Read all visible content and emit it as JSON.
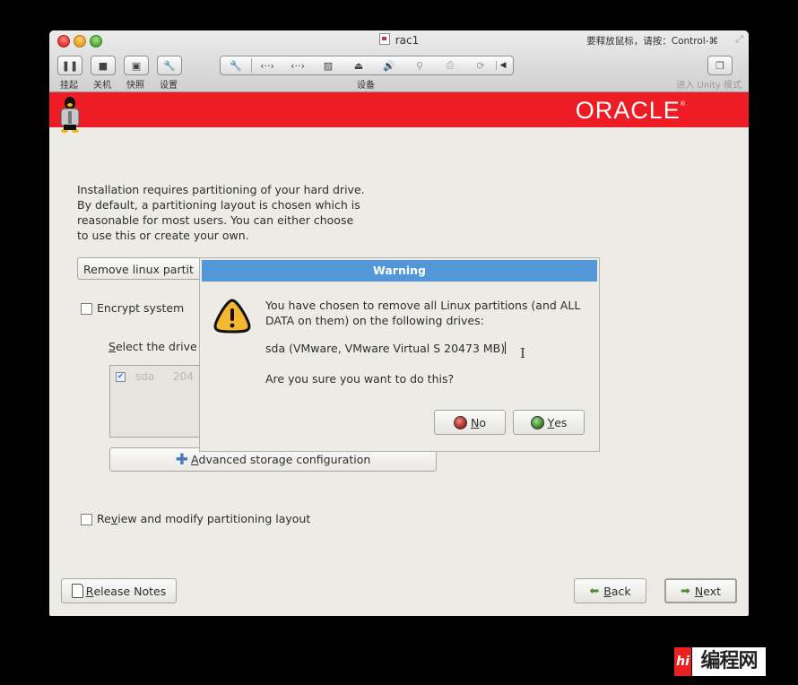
{
  "window": {
    "title": "rac1",
    "release_hint": "要释放鼠标，请按：Control-⌘",
    "toolbar": [
      {
        "label": "挂起",
        "icon": "pause-icon",
        "glyph": "❚❚"
      },
      {
        "label": "关机",
        "icon": "stop-icon",
        "glyph": "■"
      },
      {
        "label": "快照",
        "icon": "snapshot-icon",
        "glyph": "▣"
      },
      {
        "label": "设置",
        "icon": "wrench-icon",
        "glyph": "🔧"
      }
    ],
    "devices_label": "设备",
    "devices": [
      {
        "icon": "device-settings-icon",
        "glyph": "🔧"
      },
      {
        "icon": "network-adapter-icon",
        "glyph": "‹··›"
      },
      {
        "icon": "network-adapter-2-icon",
        "glyph": "‹··›"
      },
      {
        "icon": "hard-disk-icon",
        "glyph": "▨"
      },
      {
        "icon": "cd-dvd-icon",
        "glyph": "⏏"
      },
      {
        "icon": "sound-icon",
        "glyph": "🔊"
      },
      {
        "icon": "usb-icon",
        "glyph": "⚲"
      },
      {
        "icon": "printer-icon",
        "glyph": "⎙"
      },
      {
        "icon": "camera-icon",
        "glyph": "⟳"
      }
    ],
    "unity_label": "进入 Unity 模式"
  },
  "banner": {
    "logo_text": "ORACLE",
    "logo_mark": "®",
    "color": "#ee1c25"
  },
  "installer": {
    "intro_lines": [
      "Installation requires partitioning of your hard drive.",
      "By default, a partitioning layout is chosen which is",
      "reasonable for most users.  You can either choose",
      "to use this or create your own."
    ],
    "partition_combo_value": "Remove linux partit",
    "encrypt_label": "Encrypt system",
    "encrypt_checked": false,
    "select_drives_label_accel": "S",
    "select_drives_label_rest": "elect the drive",
    "drives": [
      {
        "name": "sda",
        "size": "204",
        "checked": true
      }
    ],
    "advanced_button_accel": "A",
    "advanced_button_rest": "dvanced storage configuration",
    "review_label_pre": "Re",
    "review_label_accel": "v",
    "review_label_rest": "iew and modify partitioning layout",
    "review_checked": false,
    "release_notes_accel": "R",
    "release_notes_rest": "elease Notes",
    "back_accel": "B",
    "back_rest": "ack",
    "next_accel": "N",
    "next_rest": "ext"
  },
  "dialog": {
    "title": "Warning",
    "title_color": "#5497d8",
    "message": "You have chosen to remove all Linux partitions (and ALL DATA on them) on the following drives:",
    "drive_line": "sda (VMware, VMware Virtual S 20473 MB)",
    "question": "Are you sure you want to do this?",
    "no_accel": "N",
    "no_rest": "o",
    "yes_accel": "Y",
    "yes_rest": "es"
  },
  "watermark": {
    "badge": "hi",
    "text": "编程网"
  }
}
